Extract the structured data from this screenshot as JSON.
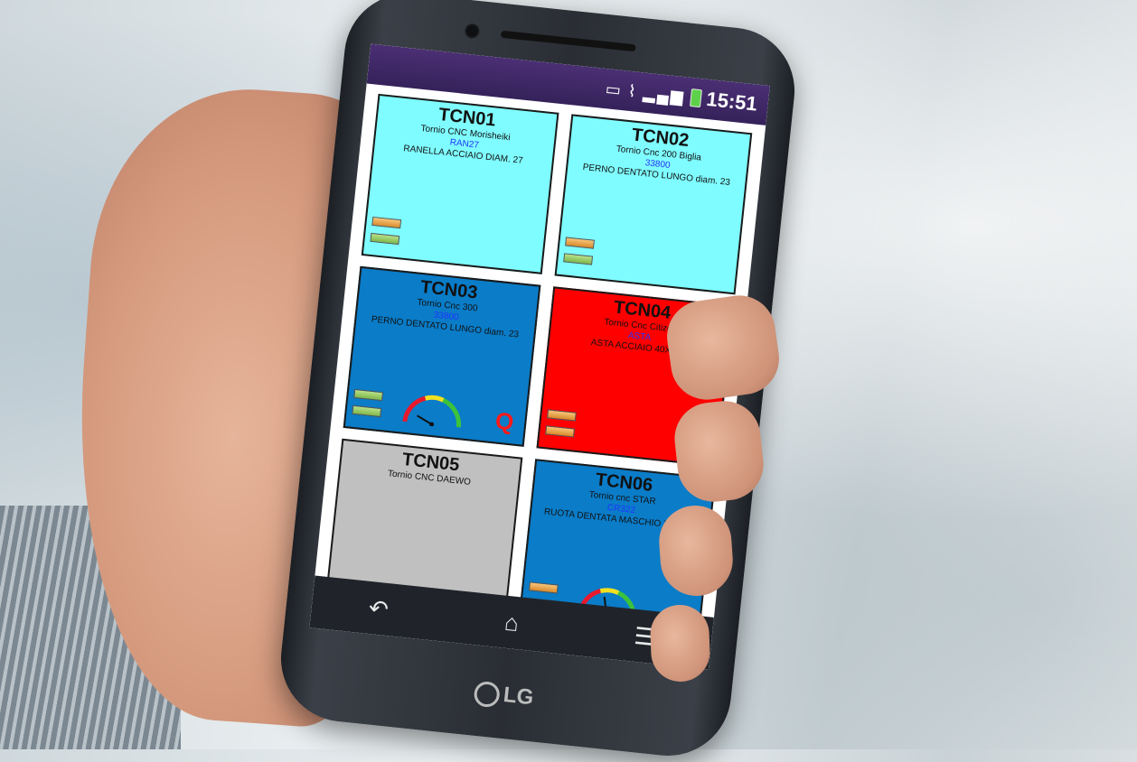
{
  "status_bar": {
    "icons": [
      "vibrate-icon",
      "wifi-icon",
      "signal-icon",
      "battery-icon"
    ],
    "time": "15:51"
  },
  "tiles": [
    {
      "id": "TCN01",
      "machine": "Tornio CNC Morisheiki",
      "code": "RAN27",
      "part": "RANELLA ACCIAIO DIAM. 27",
      "color": "#7ffcff",
      "gauge": false,
      "q": false
    },
    {
      "id": "TCN02",
      "machine": "Tornio Cnc 200 Biglia",
      "code": "33800",
      "part": "PERNO DENTATO LUNGO diam. 23",
      "color": "#7ffcff",
      "gauge": false,
      "q": false
    },
    {
      "id": "TCN03",
      "machine": "Tornio Cnc 300",
      "code": "33800",
      "part": "PERNO DENTATO LUNGO diam. 23",
      "color": "#0a7cc8",
      "gauge": true,
      "q": true,
      "q_label": "Q"
    },
    {
      "id": "TCN04",
      "machine": "Tornio Cnc Citizen",
      "code": "ASTA",
      "part": "ASTA ACCIAIO 40X200",
      "color": "#ff0000",
      "gauge": false,
      "q": false
    },
    {
      "id": "TCN05",
      "machine": "Tornio CNC DAEWO",
      "code": "",
      "part": "",
      "color": "#c0c0c0",
      "gauge": false,
      "q": false
    },
    {
      "id": "TCN06",
      "machine": "Tornio cnc STAR",
      "code": "CR322",
      "part": "RUOTA DENTATA MASCHIO Z30 L80",
      "color": "#0a7cc8",
      "gauge": true,
      "q": false
    }
  ],
  "nav": {
    "back_icon": "back-icon",
    "home_icon": "home-icon",
    "menu_icon": "menu-icon"
  },
  "brand": "LG"
}
